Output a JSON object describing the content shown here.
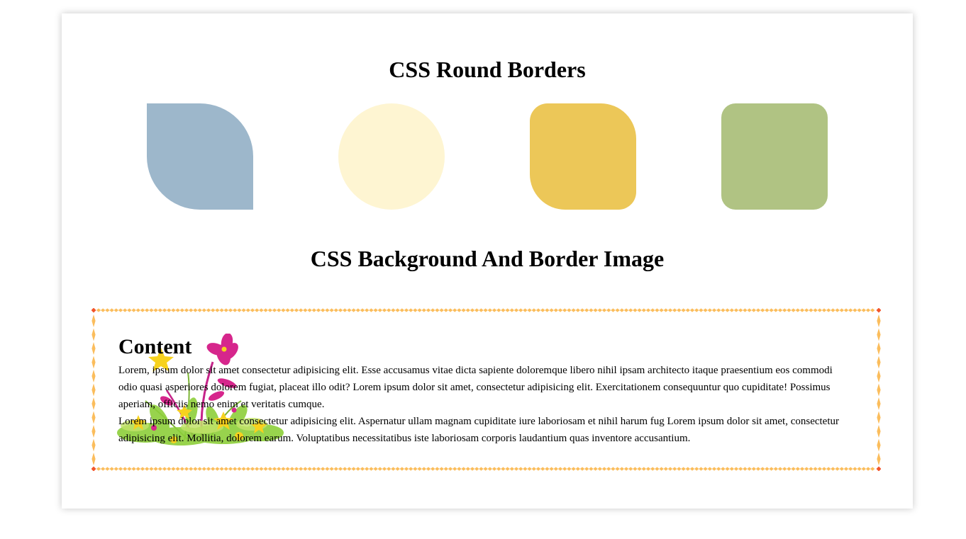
{
  "headings": {
    "round_borders": "CSS Round Borders",
    "background_border_image": "CSS Background And Border Image"
  },
  "shapes": [
    {
      "name": "leaf-shape",
      "color": "#9db7cb"
    },
    {
      "name": "circle-shape",
      "color": "#fef5d2"
    },
    {
      "name": "rounded-shape",
      "color": "#ecc758"
    },
    {
      "name": "rounded-square-shape",
      "color": "#b0c383"
    }
  ],
  "content": {
    "heading": "Content",
    "paragraph_1": "Lorem, ipsum dolor sit amet consectetur adipisicing elit. Esse accusamus vitae dicta sapiente doloremque libero nihil ipsam architecto itaque praesentium eos commodi odio quasi asperiores dolorem fugiat, placeat illo odit? Lorem ipsum dolor sit amet, consectetur adipisicing elit. Exercitationem consequuntur quo cupiditate! Possimus aperiam, officiis nemo enim et veritatis cumque.",
    "paragraph_2": "Lorem ipsum dolor sit amet consectetur adipisicing elit. Aspernatur ullam magnam cupiditate iure laboriosam et nihil harum fug Lorem ipsum dolor sit amet, consectetur adipisicing elit. Mollitia, dolorem earum. Voluptatibus necessitatibus iste laboriosam corporis laudantium quas inventore accusantium."
  },
  "colors": {
    "border_diamond": "#fbbd5c",
    "border_corner": "#f2552b",
    "flower_magenta": "#d6268c",
    "flower_yellow": "#f7d21e",
    "leaf_green": "#8dcf3a"
  },
  "icons": {
    "background": "flower-bouquet-illustration"
  }
}
